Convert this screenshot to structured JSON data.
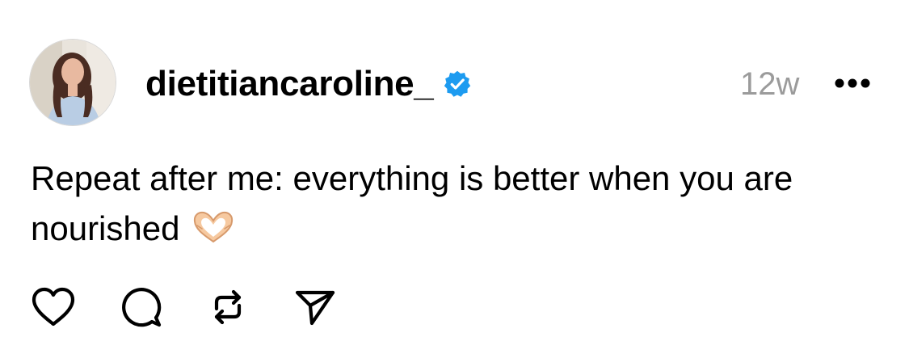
{
  "post": {
    "avatar_icon": "profile-photo-avatar",
    "username": "dietitiancaroline_",
    "verified_icon": "verified-badge-icon",
    "timestamp": "12w",
    "more_icon": "more-options-icon",
    "caption_text": "Repeat after me: everything is better when you are nourished",
    "caption_emoji": "heart-hands-emoji"
  },
  "actions": [
    {
      "name": "like",
      "icon": "heart-icon"
    },
    {
      "name": "comment",
      "icon": "comment-icon"
    },
    {
      "name": "repost",
      "icon": "repost-icon"
    },
    {
      "name": "share",
      "icon": "send-icon"
    }
  ],
  "colors": {
    "text": "#000000",
    "muted": "#9b9b9b",
    "verified_blue": "#1d9bf0",
    "background": "#ffffff"
  }
}
